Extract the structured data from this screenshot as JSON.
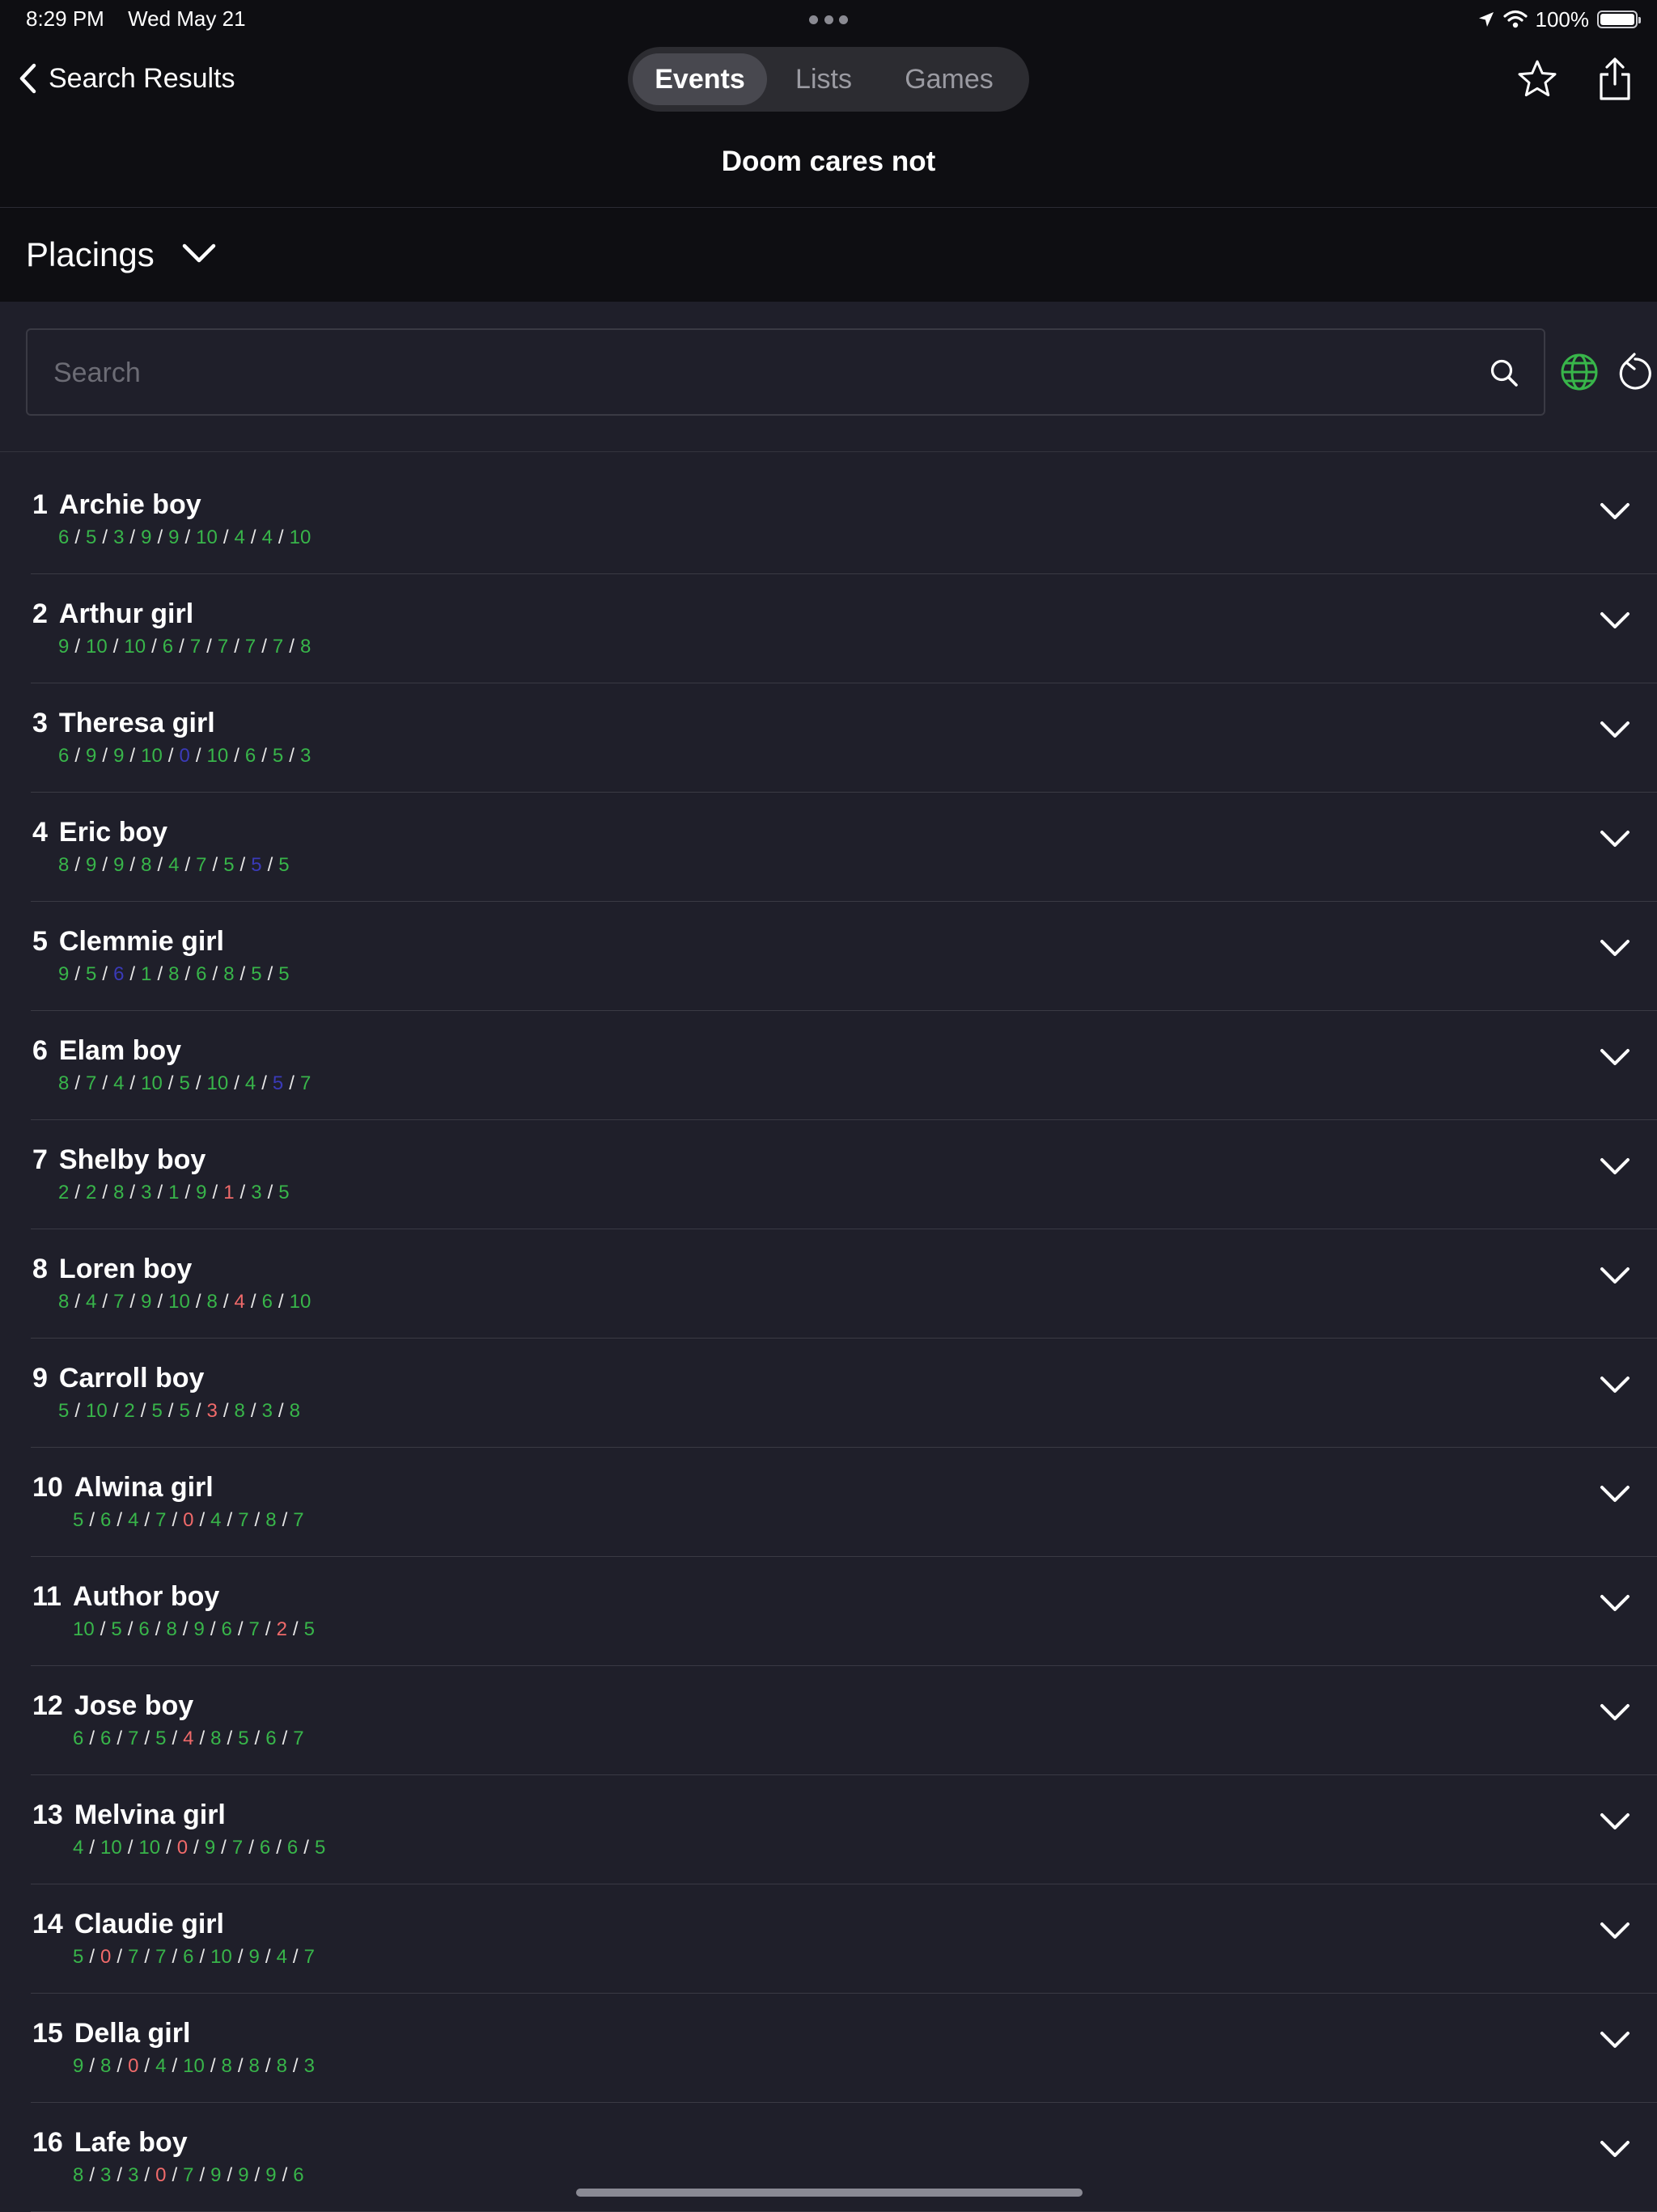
{
  "status_bar": {
    "time": "8:29 PM",
    "date": "Wed May 21",
    "battery": "100%",
    "battery_level": 1.0
  },
  "nav": {
    "back_label": "Search Results",
    "tabs": [
      {
        "label": "Events",
        "active": true
      },
      {
        "label": "Lists",
        "active": false
      },
      {
        "label": "Games",
        "active": false
      }
    ],
    "title": "Doom cares not"
  },
  "section": {
    "title": "Placings"
  },
  "search": {
    "placeholder": "Search",
    "value": ""
  },
  "colors": {
    "green": "#38b54a",
    "red": "#f06a6a",
    "blue": "#3a3ab8"
  },
  "rows": [
    {
      "rank": "1",
      "name": "Archie boy",
      "scores": [
        {
          "v": "6",
          "c": "green"
        },
        {
          "v": "5",
          "c": "green"
        },
        {
          "v": "3",
          "c": "green"
        },
        {
          "v": "9",
          "c": "green"
        },
        {
          "v": "9",
          "c": "green"
        },
        {
          "v": "10",
          "c": "green"
        },
        {
          "v": "4",
          "c": "green"
        },
        {
          "v": "4",
          "c": "green"
        },
        {
          "v": "10",
          "c": "green"
        }
      ]
    },
    {
      "rank": "2",
      "name": "Arthur girl",
      "scores": [
        {
          "v": "9",
          "c": "green"
        },
        {
          "v": "10",
          "c": "green"
        },
        {
          "v": "10",
          "c": "green"
        },
        {
          "v": "6",
          "c": "green"
        },
        {
          "v": "7",
          "c": "green"
        },
        {
          "v": "7",
          "c": "green"
        },
        {
          "v": "7",
          "c": "green"
        },
        {
          "v": "7",
          "c": "green"
        },
        {
          "v": "8",
          "c": "green"
        }
      ]
    },
    {
      "rank": "3",
      "name": "Theresa girl",
      "scores": [
        {
          "v": "6",
          "c": "green"
        },
        {
          "v": "9",
          "c": "green"
        },
        {
          "v": "9",
          "c": "green"
        },
        {
          "v": "10",
          "c": "green"
        },
        {
          "v": "0",
          "c": "blue"
        },
        {
          "v": "10",
          "c": "green"
        },
        {
          "v": "6",
          "c": "green"
        },
        {
          "v": "5",
          "c": "green"
        },
        {
          "v": "3",
          "c": "green"
        }
      ]
    },
    {
      "rank": "4",
      "name": "Eric boy",
      "scores": [
        {
          "v": "8",
          "c": "green"
        },
        {
          "v": "9",
          "c": "green"
        },
        {
          "v": "9",
          "c": "green"
        },
        {
          "v": "8",
          "c": "green"
        },
        {
          "v": "4",
          "c": "green"
        },
        {
          "v": "7",
          "c": "green"
        },
        {
          "v": "5",
          "c": "green"
        },
        {
          "v": "5",
          "c": "blue"
        },
        {
          "v": "5",
          "c": "green"
        }
      ]
    },
    {
      "rank": "5",
      "name": "Clemmie girl",
      "scores": [
        {
          "v": "9",
          "c": "green"
        },
        {
          "v": "5",
          "c": "green"
        },
        {
          "v": "6",
          "c": "blue"
        },
        {
          "v": "1",
          "c": "green"
        },
        {
          "v": "8",
          "c": "green"
        },
        {
          "v": "6",
          "c": "green"
        },
        {
          "v": "8",
          "c": "green"
        },
        {
          "v": "5",
          "c": "green"
        },
        {
          "v": "5",
          "c": "green"
        }
      ]
    },
    {
      "rank": "6",
      "name": "Elam boy",
      "scores": [
        {
          "v": "8",
          "c": "green"
        },
        {
          "v": "7",
          "c": "green"
        },
        {
          "v": "4",
          "c": "green"
        },
        {
          "v": "10",
          "c": "green"
        },
        {
          "v": "5",
          "c": "green"
        },
        {
          "v": "10",
          "c": "green"
        },
        {
          "v": "4",
          "c": "green"
        },
        {
          "v": "5",
          "c": "blue"
        },
        {
          "v": "7",
          "c": "green"
        }
      ]
    },
    {
      "rank": "7",
      "name": "Shelby boy",
      "scores": [
        {
          "v": "2",
          "c": "green"
        },
        {
          "v": "2",
          "c": "green"
        },
        {
          "v": "8",
          "c": "green"
        },
        {
          "v": "3",
          "c": "green"
        },
        {
          "v": "1",
          "c": "green"
        },
        {
          "v": "9",
          "c": "green"
        },
        {
          "v": "1",
          "c": "red"
        },
        {
          "v": "3",
          "c": "green"
        },
        {
          "v": "5",
          "c": "green"
        }
      ]
    },
    {
      "rank": "8",
      "name": "Loren boy",
      "scores": [
        {
          "v": "8",
          "c": "green"
        },
        {
          "v": "4",
          "c": "green"
        },
        {
          "v": "7",
          "c": "green"
        },
        {
          "v": "9",
          "c": "green"
        },
        {
          "v": "10",
          "c": "green"
        },
        {
          "v": "8",
          "c": "green"
        },
        {
          "v": "4",
          "c": "red"
        },
        {
          "v": "6",
          "c": "green"
        },
        {
          "v": "10",
          "c": "green"
        }
      ]
    },
    {
      "rank": "9",
      "name": "Carroll boy",
      "scores": [
        {
          "v": "5",
          "c": "green"
        },
        {
          "v": "10",
          "c": "green"
        },
        {
          "v": "2",
          "c": "green"
        },
        {
          "v": "5",
          "c": "green"
        },
        {
          "v": "5",
          "c": "green"
        },
        {
          "v": "3",
          "c": "red"
        },
        {
          "v": "8",
          "c": "green"
        },
        {
          "v": "3",
          "c": "green"
        },
        {
          "v": "8",
          "c": "green"
        }
      ]
    },
    {
      "rank": "10",
      "name": "Alwina girl",
      "scores": [
        {
          "v": "5",
          "c": "green"
        },
        {
          "v": "6",
          "c": "green"
        },
        {
          "v": "4",
          "c": "green"
        },
        {
          "v": "7",
          "c": "green"
        },
        {
          "v": "0",
          "c": "red"
        },
        {
          "v": "4",
          "c": "green"
        },
        {
          "v": "7",
          "c": "green"
        },
        {
          "v": "8",
          "c": "green"
        },
        {
          "v": "7",
          "c": "green"
        }
      ]
    },
    {
      "rank": "11",
      "name": "Author boy",
      "scores": [
        {
          "v": "10",
          "c": "green"
        },
        {
          "v": "5",
          "c": "green"
        },
        {
          "v": "6",
          "c": "green"
        },
        {
          "v": "8",
          "c": "green"
        },
        {
          "v": "9",
          "c": "green"
        },
        {
          "v": "6",
          "c": "green"
        },
        {
          "v": "7",
          "c": "green"
        },
        {
          "v": "2",
          "c": "red"
        },
        {
          "v": "5",
          "c": "green"
        }
      ]
    },
    {
      "rank": "12",
      "name": "Jose boy",
      "scores": [
        {
          "v": "6",
          "c": "green"
        },
        {
          "v": "6",
          "c": "green"
        },
        {
          "v": "7",
          "c": "green"
        },
        {
          "v": "5",
          "c": "green"
        },
        {
          "v": "4",
          "c": "red"
        },
        {
          "v": "8",
          "c": "green"
        },
        {
          "v": "5",
          "c": "green"
        },
        {
          "v": "6",
          "c": "green"
        },
        {
          "v": "7",
          "c": "green"
        }
      ]
    },
    {
      "rank": "13",
      "name": "Melvina girl",
      "scores": [
        {
          "v": "4",
          "c": "green"
        },
        {
          "v": "10",
          "c": "green"
        },
        {
          "v": "10",
          "c": "green"
        },
        {
          "v": "0",
          "c": "red"
        },
        {
          "v": "9",
          "c": "green"
        },
        {
          "v": "7",
          "c": "green"
        },
        {
          "v": "6",
          "c": "green"
        },
        {
          "v": "6",
          "c": "green"
        },
        {
          "v": "5",
          "c": "green"
        }
      ]
    },
    {
      "rank": "14",
      "name": "Claudie girl",
      "scores": [
        {
          "v": "5",
          "c": "green"
        },
        {
          "v": "0",
          "c": "red"
        },
        {
          "v": "7",
          "c": "green"
        },
        {
          "v": "7",
          "c": "green"
        },
        {
          "v": "6",
          "c": "green"
        },
        {
          "v": "10",
          "c": "green"
        },
        {
          "v": "9",
          "c": "green"
        },
        {
          "v": "4",
          "c": "green"
        },
        {
          "v": "7",
          "c": "green"
        }
      ]
    },
    {
      "rank": "15",
      "name": "Della girl",
      "scores": [
        {
          "v": "9",
          "c": "green"
        },
        {
          "v": "8",
          "c": "green"
        },
        {
          "v": "0",
          "c": "red"
        },
        {
          "v": "4",
          "c": "green"
        },
        {
          "v": "10",
          "c": "green"
        },
        {
          "v": "8",
          "c": "green"
        },
        {
          "v": "8",
          "c": "green"
        },
        {
          "v": "8",
          "c": "green"
        },
        {
          "v": "3",
          "c": "green"
        }
      ]
    },
    {
      "rank": "16",
      "name": "Lafe boy",
      "scores": [
        {
          "v": "8",
          "c": "green"
        },
        {
          "v": "3",
          "c": "green"
        },
        {
          "v": "3",
          "c": "green"
        },
        {
          "v": "0",
          "c": "red"
        },
        {
          "v": "7",
          "c": "green"
        },
        {
          "v": "9",
          "c": "green"
        },
        {
          "v": "9",
          "c": "green"
        },
        {
          "v": "9",
          "c": "green"
        },
        {
          "v": "6",
          "c": "green"
        }
      ]
    }
  ]
}
